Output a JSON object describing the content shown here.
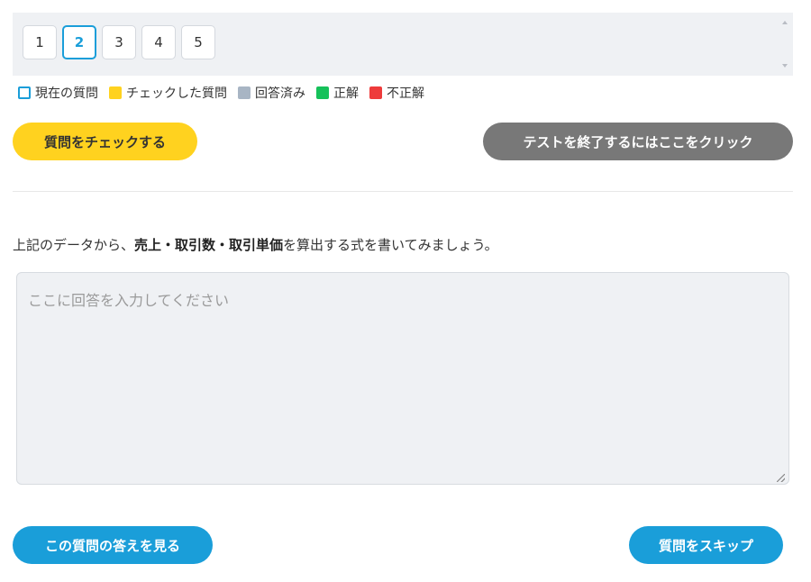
{
  "question_nav": {
    "numbers": [
      "1",
      "2",
      "3",
      "4",
      "5"
    ],
    "current": "2"
  },
  "legend": {
    "current": "現在の質問",
    "checked": "チェックした質問",
    "answered": "回答済み",
    "correct": "正解",
    "incorrect": "不正解"
  },
  "colors": {
    "accent_blue": "#1a9ed9",
    "check_yellow": "#ffd21f",
    "answered_gray": "#a8b5c4",
    "correct_green": "#16c15a",
    "incorrect_red": "#ee3b3b",
    "finish_gray": "#787878"
  },
  "actions": {
    "check_question": "質問をチェックする",
    "finish_test": "テストを終了するにはここをクリック",
    "show_answer": "この質問の答えを見る",
    "skip_question": "質問をスキップ"
  },
  "question": {
    "prefix": "上記のデータから、",
    "bold": "売上・取引数・取引単価",
    "suffix": "を算出する式を書いてみましょう。"
  },
  "answer": {
    "placeholder": "ここに回答を入力してください",
    "value": ""
  }
}
